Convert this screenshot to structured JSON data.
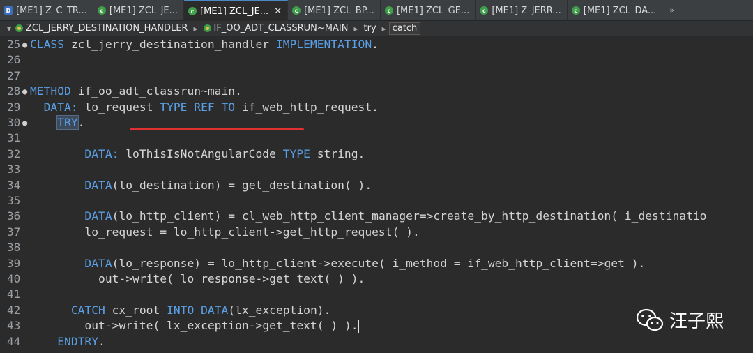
{
  "tabs": [
    {
      "label": "[ME1] Z_C_TR...",
      "icon": "d-icon",
      "active": false
    },
    {
      "label": "[ME1] ZCL_JE...",
      "icon": "class-icon",
      "active": false
    },
    {
      "label": "[ME1] ZCL_JE...",
      "icon": "class-icon",
      "active": true
    },
    {
      "label": "[ME1] ZCL_BP...",
      "icon": "class-icon",
      "active": false
    },
    {
      "label": "[ME1] ZCL_GE...",
      "icon": "class-icon",
      "active": false
    },
    {
      "label": "[ME1] Z_JERR...",
      "icon": "class-icon",
      "active": false
    },
    {
      "label": "[ME1] ZCL_DA...",
      "icon": "class-icon",
      "active": false
    }
  ],
  "tab_overflow": "»",
  "breadcrumb": {
    "class": "ZCL_JERRY_DESTINATION_HANDLER",
    "method": "IF_OO_ADT_CLASSRUN~MAIN",
    "try": "try",
    "catch": "catch"
  },
  "lines": [
    {
      "num": "25",
      "fold": true,
      "tokens": [
        [
          "kw",
          "CLASS"
        ],
        [
          "id",
          " zcl_jerry_destination_handler "
        ],
        [
          "kw",
          "IMPLEMENTATION"
        ],
        [
          "op",
          "."
        ]
      ]
    },
    {
      "num": "26",
      "fold": false,
      "tokens": []
    },
    {
      "num": "27",
      "fold": false,
      "tokens": []
    },
    {
      "num": "28",
      "fold": true,
      "tokens": [
        [
          "kw",
          "METHOD"
        ],
        [
          "id",
          " if_oo_adt_classrun~main"
        ],
        [
          "op",
          "."
        ]
      ]
    },
    {
      "num": "29",
      "fold": false,
      "tokens": [
        [
          "id",
          "  "
        ],
        [
          "kw",
          "DATA:"
        ],
        [
          "id",
          " lo_request "
        ],
        [
          "kw",
          "TYPE REF TO"
        ],
        [
          "id",
          " if_web_http_request"
        ],
        [
          "op",
          "."
        ]
      ]
    },
    {
      "num": "30",
      "fold": true,
      "tokens": [
        [
          "id",
          "    "
        ],
        [
          "try",
          "TRY"
        ],
        [
          "op",
          "."
        ]
      ]
    },
    {
      "num": "31",
      "fold": false,
      "tokens": []
    },
    {
      "num": "32",
      "fold": false,
      "tokens": [
        [
          "id",
          "        "
        ],
        [
          "kw",
          "DATA:"
        ],
        [
          "id",
          " loThisIsNotAngularCode "
        ],
        [
          "kw",
          "TYPE"
        ],
        [
          "id",
          " string"
        ],
        [
          "op",
          "."
        ]
      ]
    },
    {
      "num": "33",
      "fold": false,
      "tokens": []
    },
    {
      "num": "34",
      "fold": false,
      "tokens": [
        [
          "id",
          "        "
        ],
        [
          "kw",
          "DATA"
        ],
        [
          "op",
          "("
        ],
        [
          "id",
          "lo_destination"
        ],
        [
          "op",
          ") = "
        ],
        [
          "id",
          "get_destination"
        ],
        [
          "op",
          "( )."
        ]
      ]
    },
    {
      "num": "35",
      "fold": false,
      "tokens": []
    },
    {
      "num": "36",
      "fold": false,
      "tokens": [
        [
          "id",
          "        "
        ],
        [
          "kw",
          "DATA"
        ],
        [
          "op",
          "("
        ],
        [
          "id",
          "lo_http_client"
        ],
        [
          "op",
          ") = "
        ],
        [
          "id",
          "cl_web_http_client_manager"
        ],
        [
          "op",
          "=>"
        ],
        [
          "id",
          "create_by_http_destination"
        ],
        [
          "op",
          "( "
        ],
        [
          "id",
          "i_destinatio"
        ]
      ]
    },
    {
      "num": "37",
      "fold": false,
      "tokens": [
        [
          "id",
          "        lo_request "
        ],
        [
          "op",
          "= "
        ],
        [
          "id",
          "lo_http_client"
        ],
        [
          "op",
          "->"
        ],
        [
          "id",
          "get_http_request"
        ],
        [
          "op",
          "( )."
        ]
      ]
    },
    {
      "num": "38",
      "fold": false,
      "tokens": []
    },
    {
      "num": "39",
      "fold": false,
      "tokens": [
        [
          "id",
          "        "
        ],
        [
          "kw",
          "DATA"
        ],
        [
          "op",
          "("
        ],
        [
          "id",
          "lo_response"
        ],
        [
          "op",
          ") = "
        ],
        [
          "id",
          "lo_http_client"
        ],
        [
          "op",
          "->"
        ],
        [
          "id",
          "execute"
        ],
        [
          "op",
          "( "
        ],
        [
          "id",
          "i_method "
        ],
        [
          "op",
          "= "
        ],
        [
          "id",
          "if_web_http_client"
        ],
        [
          "op",
          "=>"
        ],
        [
          "id",
          "get "
        ],
        [
          "op",
          ")."
        ]
      ]
    },
    {
      "num": "40",
      "fold": false,
      "tokens": [
        [
          "id",
          "          out"
        ],
        [
          "op",
          "->"
        ],
        [
          "id",
          "write"
        ],
        [
          "op",
          "( "
        ],
        [
          "id",
          "lo_response"
        ],
        [
          "op",
          "->"
        ],
        [
          "id",
          "get_text"
        ],
        [
          "op",
          "( ) )."
        ]
      ]
    },
    {
      "num": "41",
      "fold": false,
      "tokens": []
    },
    {
      "num": "42",
      "fold": false,
      "tokens": [
        [
          "id",
          "      "
        ],
        [
          "kw",
          "CATCH"
        ],
        [
          "id",
          " cx_root "
        ],
        [
          "kw",
          "INTO DATA"
        ],
        [
          "op",
          "("
        ],
        [
          "id",
          "lx_exception"
        ],
        [
          "op",
          ")."
        ]
      ]
    },
    {
      "num": "43",
      "fold": false,
      "tokens": [
        [
          "id",
          "        out"
        ],
        [
          "op",
          "->"
        ],
        [
          "id",
          "write"
        ],
        [
          "op",
          "( "
        ],
        [
          "id",
          "lx_exception"
        ],
        [
          "op",
          "->"
        ],
        [
          "id",
          "get_text"
        ],
        [
          "op",
          "( ) )."
        ],
        [
          "caret",
          ""
        ]
      ]
    },
    {
      "num": "44",
      "fold": false,
      "tokens": [
        [
          "id",
          "    "
        ],
        [
          "kw",
          "ENDTRY"
        ],
        [
          "op",
          "."
        ]
      ]
    }
  ],
  "watermark": {
    "text": "汪子熙",
    "icon": "wechat-icon"
  },
  "colors": {
    "keyword": "#5aa0e6",
    "text": "#d4d4d4",
    "underline": "#e03030",
    "background": "#2b2b2b"
  }
}
